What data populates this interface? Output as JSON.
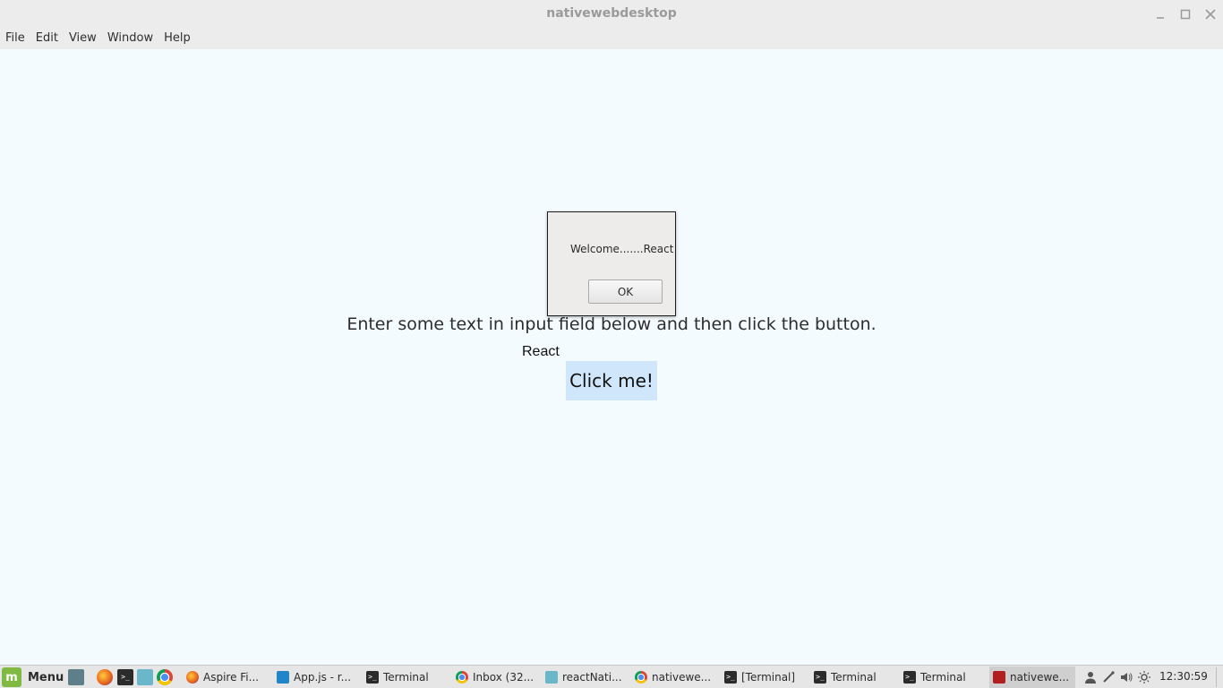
{
  "window": {
    "title": "nativewebdesktop",
    "controls": {
      "minimize": "minimize-icon",
      "maximize": "maximize-icon",
      "close": "close-icon"
    }
  },
  "menubar": {
    "items": [
      "File",
      "Edit",
      "View",
      "Window",
      "Help"
    ]
  },
  "main": {
    "prompt": "Enter some text in input field below and then click the button.",
    "input_value": "React",
    "button_label": "Click me!",
    "button_color": "#cfe6fb",
    "background_color": "#f4fbfe"
  },
  "dialog": {
    "message": "Welcome.......React",
    "ok_label": "OK"
  },
  "taskbar": {
    "menu_label": "Menu",
    "launchers": [
      "show-desktop-icon",
      "firefox-icon",
      "terminal-icon",
      "files-icon",
      "chrome-icon"
    ],
    "tasks": [
      {
        "label": "Aspire Fi...",
        "icon": "firefox-icon"
      },
      {
        "label": "App.js - r...",
        "icon": "vscode-icon"
      },
      {
        "label": "Terminal",
        "icon": "terminal-icon"
      },
      {
        "label": "Inbox (32...",
        "icon": "chrome-icon"
      },
      {
        "label": "reactNati...",
        "icon": "folder-icon"
      },
      {
        "label": "nativewe...",
        "icon": "chrome-icon"
      },
      {
        "label": "[Terminal]",
        "icon": "terminal-icon"
      },
      {
        "label": "Terminal",
        "icon": "terminal-icon"
      },
      {
        "label": "Terminal",
        "icon": "terminal-icon"
      },
      {
        "label": "nativewe...",
        "icon": "nativeweb-icon",
        "active": true
      }
    ],
    "tray": [
      "user-icon",
      "network-icon",
      "volume-icon",
      "brightness-icon"
    ],
    "clock": "12:30:59"
  }
}
